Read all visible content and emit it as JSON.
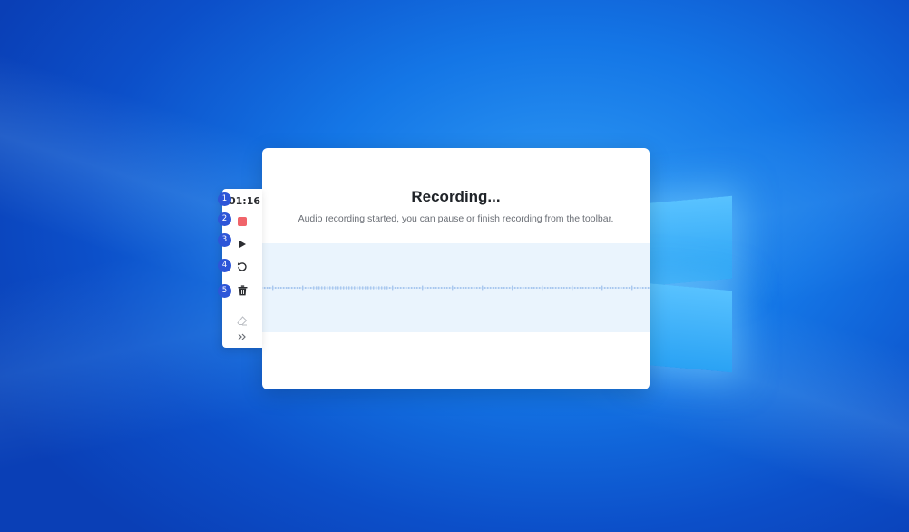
{
  "recording": {
    "title": "Recording...",
    "subtitle": "Audio recording started, you can pause or finish recording from the toolbar."
  },
  "toolbar": {
    "timer": "01:16",
    "items": [
      {
        "name": "stop-button",
        "icon": "stop-icon"
      },
      {
        "name": "play-button",
        "icon": "play-icon"
      },
      {
        "name": "restart-button",
        "icon": "restart-icon"
      },
      {
        "name": "delete-button",
        "icon": "trash-icon"
      },
      {
        "name": "eraser-button",
        "icon": "eraser-icon"
      },
      {
        "name": "expand-button",
        "icon": "double-chevron-right-icon"
      }
    ]
  },
  "badges": [
    "1",
    "2",
    "3",
    "4",
    "5"
  ],
  "colors": {
    "accent": "#2d56d8",
    "stop": "#f0646a",
    "waveform": "#a9c8ef",
    "wave_background": "#eaf4fd"
  }
}
